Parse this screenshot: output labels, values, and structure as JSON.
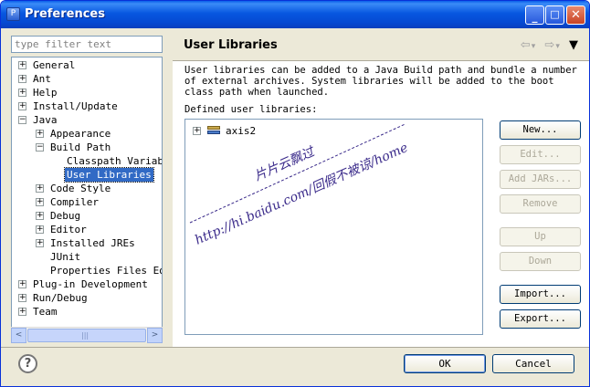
{
  "window": {
    "title": "Preferences",
    "icon": "eclipse-preferences-icon"
  },
  "titlebar_buttons": {
    "minimize": "_",
    "maximize": "□",
    "close": "✕"
  },
  "filter": {
    "placeholder": "type filter text"
  },
  "tree": {
    "items": [
      {
        "label": "General",
        "expander": "+",
        "level": 0
      },
      {
        "label": "Ant",
        "expander": "+",
        "level": 0
      },
      {
        "label": "Help",
        "expander": "+",
        "level": 0
      },
      {
        "label": "Install/Update",
        "expander": "+",
        "level": 0
      },
      {
        "label": "Java",
        "expander": "−",
        "level": 0
      },
      {
        "label": "Appearance",
        "expander": "+",
        "level": 1
      },
      {
        "label": "Build Path",
        "expander": "−",
        "level": 1
      },
      {
        "label": "Classpath Variable",
        "expander": "",
        "level": 2
      },
      {
        "label": "User Libraries",
        "expander": "",
        "level": 2,
        "selected": true
      },
      {
        "label": "Code Style",
        "expander": "+",
        "level": 1
      },
      {
        "label": "Compiler",
        "expander": "+",
        "level": 1
      },
      {
        "label": "Debug",
        "expander": "+",
        "level": 1
      },
      {
        "label": "Editor",
        "expander": "+",
        "level": 1
      },
      {
        "label": "Installed JREs",
        "expander": "+",
        "level": 1
      },
      {
        "label": "JUnit",
        "expander": "",
        "level": 1
      },
      {
        "label": "Properties Files Edit",
        "expander": "",
        "level": 1
      },
      {
        "label": "Plug-in Development",
        "expander": "+",
        "level": 0
      },
      {
        "label": "Run/Debug",
        "expander": "+",
        "level": 0
      },
      {
        "label": "Team",
        "expander": "+",
        "level": 0
      }
    ]
  },
  "scrollbar": {
    "left_arrow": "<",
    "right_arrow": ">",
    "thumb_grip": "|||"
  },
  "page": {
    "title": "User Libraries",
    "nav": {
      "back": "⇦",
      "back_dropdown": "▾",
      "forward": "⇨",
      "forward_dropdown": "▾",
      "menu": "▼"
    },
    "description": "User libraries can be added to a Java Build path and bundle a number of external archives. System libraries will be added to the boot class path when launched.",
    "defined_label": "Defined user libraries:",
    "libraries": [
      {
        "label": "axis2",
        "expander": "+",
        "icon": "library-icon"
      }
    ],
    "buttons": [
      {
        "label": "New...",
        "enabled": true
      },
      {
        "label": "Edit...",
        "enabled": false
      },
      {
        "label": "Add JARs...",
        "enabled": false
      },
      {
        "label": "Remove",
        "enabled": false
      },
      {
        "label": "Up",
        "enabled": false
      },
      {
        "label": "Down",
        "enabled": false
      },
      {
        "label": "Import...",
        "enabled": true
      },
      {
        "label": "Export...",
        "enabled": true
      }
    ]
  },
  "watermark": {
    "line1": "片片云飘过",
    "line2": "http://hi.baidu.com/回假不被谅/home",
    "color": "#3a2a8a"
  },
  "footer": {
    "help": "?",
    "ok": "OK",
    "cancel": "Cancel"
  }
}
